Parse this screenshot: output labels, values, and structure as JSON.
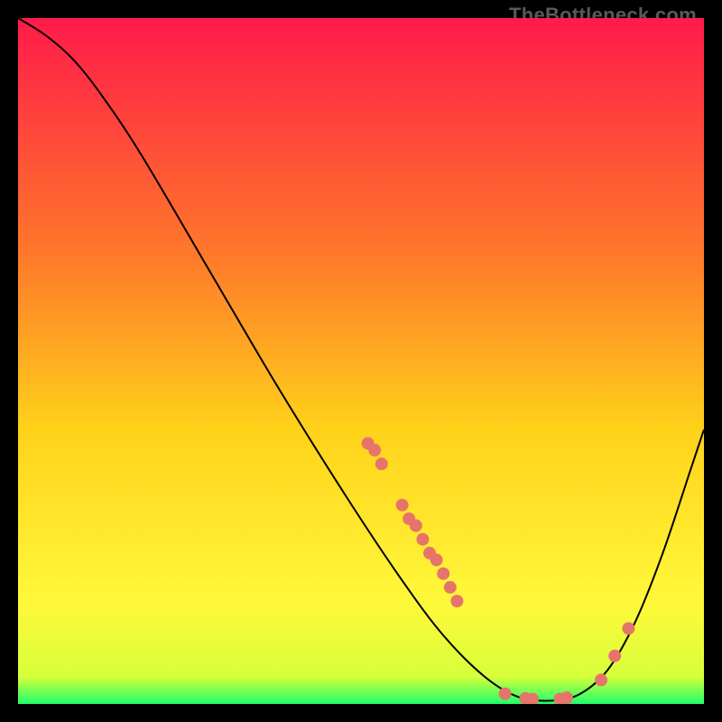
{
  "watermark": "TheBottleneck.com",
  "chart_data": {
    "type": "line",
    "title": "",
    "xlabel": "",
    "ylabel": "",
    "xlim": [
      0,
      100
    ],
    "ylim": [
      0,
      100
    ],
    "background": {
      "type": "vertical-gradient",
      "stops": [
        {
          "pos": 0,
          "color": "#ff1a4a"
        },
        {
          "pos": 35,
          "color": "#ff7a2a"
        },
        {
          "pos": 60,
          "color": "#ffd21a"
        },
        {
          "pos": 85,
          "color": "#fff83a"
        },
        {
          "pos": 96,
          "color": "#d8ff3a"
        },
        {
          "pos": 100,
          "color": "#1eff6a"
        }
      ]
    },
    "series": [
      {
        "name": "curve",
        "color": "#000000",
        "stroke_width": 2,
        "points": [
          {
            "x": 0,
            "y": 100
          },
          {
            "x": 4,
            "y": 97.5
          },
          {
            "x": 8,
            "y": 94
          },
          {
            "x": 12,
            "y": 89
          },
          {
            "x": 18,
            "y": 80
          },
          {
            "x": 28,
            "y": 63
          },
          {
            "x": 38,
            "y": 46
          },
          {
            "x": 48,
            "y": 30
          },
          {
            "x": 56,
            "y": 18
          },
          {
            "x": 62,
            "y": 10
          },
          {
            "x": 68,
            "y": 4
          },
          {
            "x": 73,
            "y": 1
          },
          {
            "x": 78,
            "y": 0.5
          },
          {
            "x": 82,
            "y": 1.5
          },
          {
            "x": 86,
            "y": 5
          },
          {
            "x": 90,
            "y": 12
          },
          {
            "x": 94,
            "y": 22
          },
          {
            "x": 98,
            "y": 34
          },
          {
            "x": 100,
            "y": 40
          }
        ]
      }
    ],
    "markers": {
      "color": "#e6746b",
      "radius": 7,
      "points": [
        {
          "x": 51,
          "y": 38
        },
        {
          "x": 52,
          "y": 37
        },
        {
          "x": 53,
          "y": 35
        },
        {
          "x": 56,
          "y": 29
        },
        {
          "x": 57,
          "y": 27
        },
        {
          "x": 58,
          "y": 26
        },
        {
          "x": 59,
          "y": 24
        },
        {
          "x": 60,
          "y": 22
        },
        {
          "x": 61,
          "y": 21
        },
        {
          "x": 62,
          "y": 19
        },
        {
          "x": 63,
          "y": 17
        },
        {
          "x": 64,
          "y": 15
        },
        {
          "x": 71,
          "y": 1.5
        },
        {
          "x": 74,
          "y": 0.8
        },
        {
          "x": 75,
          "y": 0.7
        },
        {
          "x": 79,
          "y": 0.7
        },
        {
          "x": 80,
          "y": 0.9
        },
        {
          "x": 85,
          "y": 3.5
        },
        {
          "x": 87,
          "y": 7
        },
        {
          "x": 89,
          "y": 11
        }
      ]
    }
  }
}
